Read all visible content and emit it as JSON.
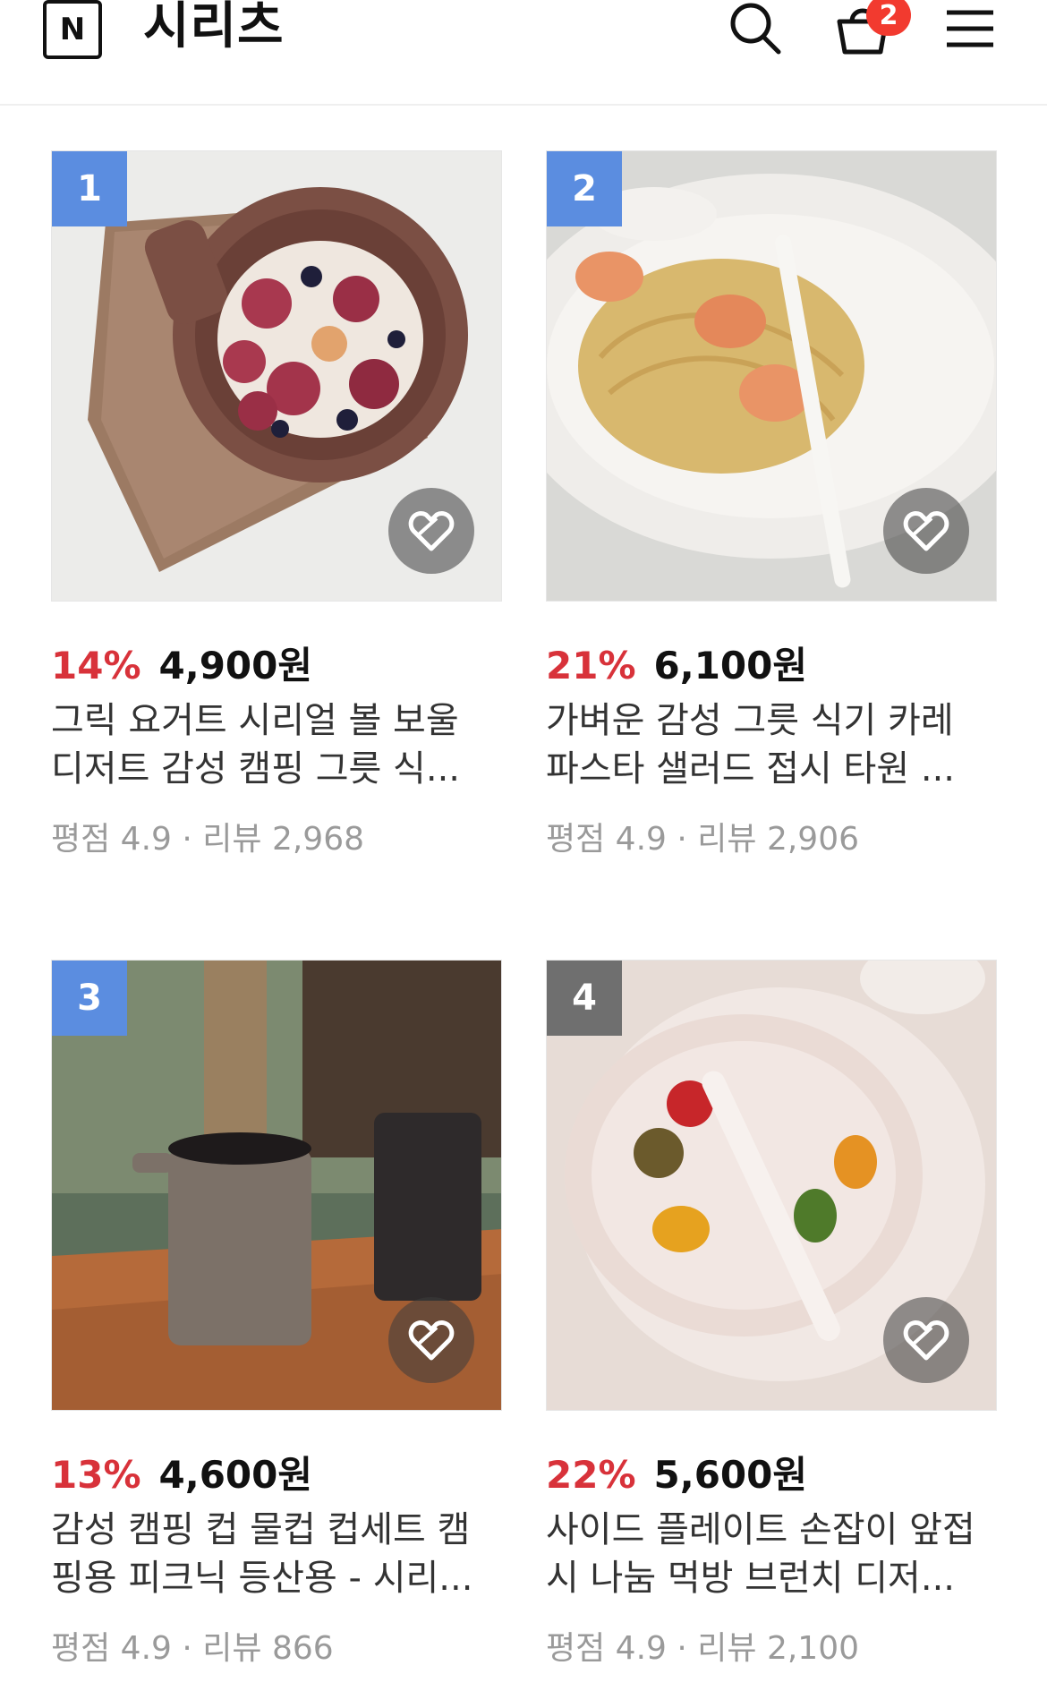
{
  "header": {
    "logo": "N",
    "title": "시리츠",
    "cart_count": "2",
    "icons": [
      "search-icon",
      "cart-icon",
      "menu-icon"
    ]
  },
  "products": [
    {
      "rank": "1",
      "discount": "14%",
      "price": "4,900원",
      "name": "그릭 요거트 시리얼 볼 보울 디저트 감성 캠핑 그릇 식...",
      "meta": "평점 4.9 · 리뷰 2,968"
    },
    {
      "rank": "2",
      "discount": "21%",
      "price": "6,100원",
      "name": "가벼운 감성 그릇 식기 카레 파스타 샐러드 접시 타원 ...",
      "meta": "평점 4.9 · 리뷰 2,906"
    },
    {
      "rank": "3",
      "discount": "13%",
      "price": "4,600원",
      "name": "감성 캠핑 컵 물컵 컵세트 캠핑용 피크닉 등산용 - 시리...",
      "meta": "평점 4.9 · 리뷰 866"
    },
    {
      "rank": "4",
      "discount": "22%",
      "price": "5,600원",
      "name": "사이드 플레이트 손잡이 앞접시 나눔 먹방 브런치 디저...",
      "meta": "평점 4.9 · 리뷰 2,100"
    }
  ],
  "colors": {
    "rank_blue": "#5b8de0",
    "rank_gray": "#6f6f6f",
    "discount_red": "#d8323a",
    "badge_red": "#f23a2f"
  }
}
